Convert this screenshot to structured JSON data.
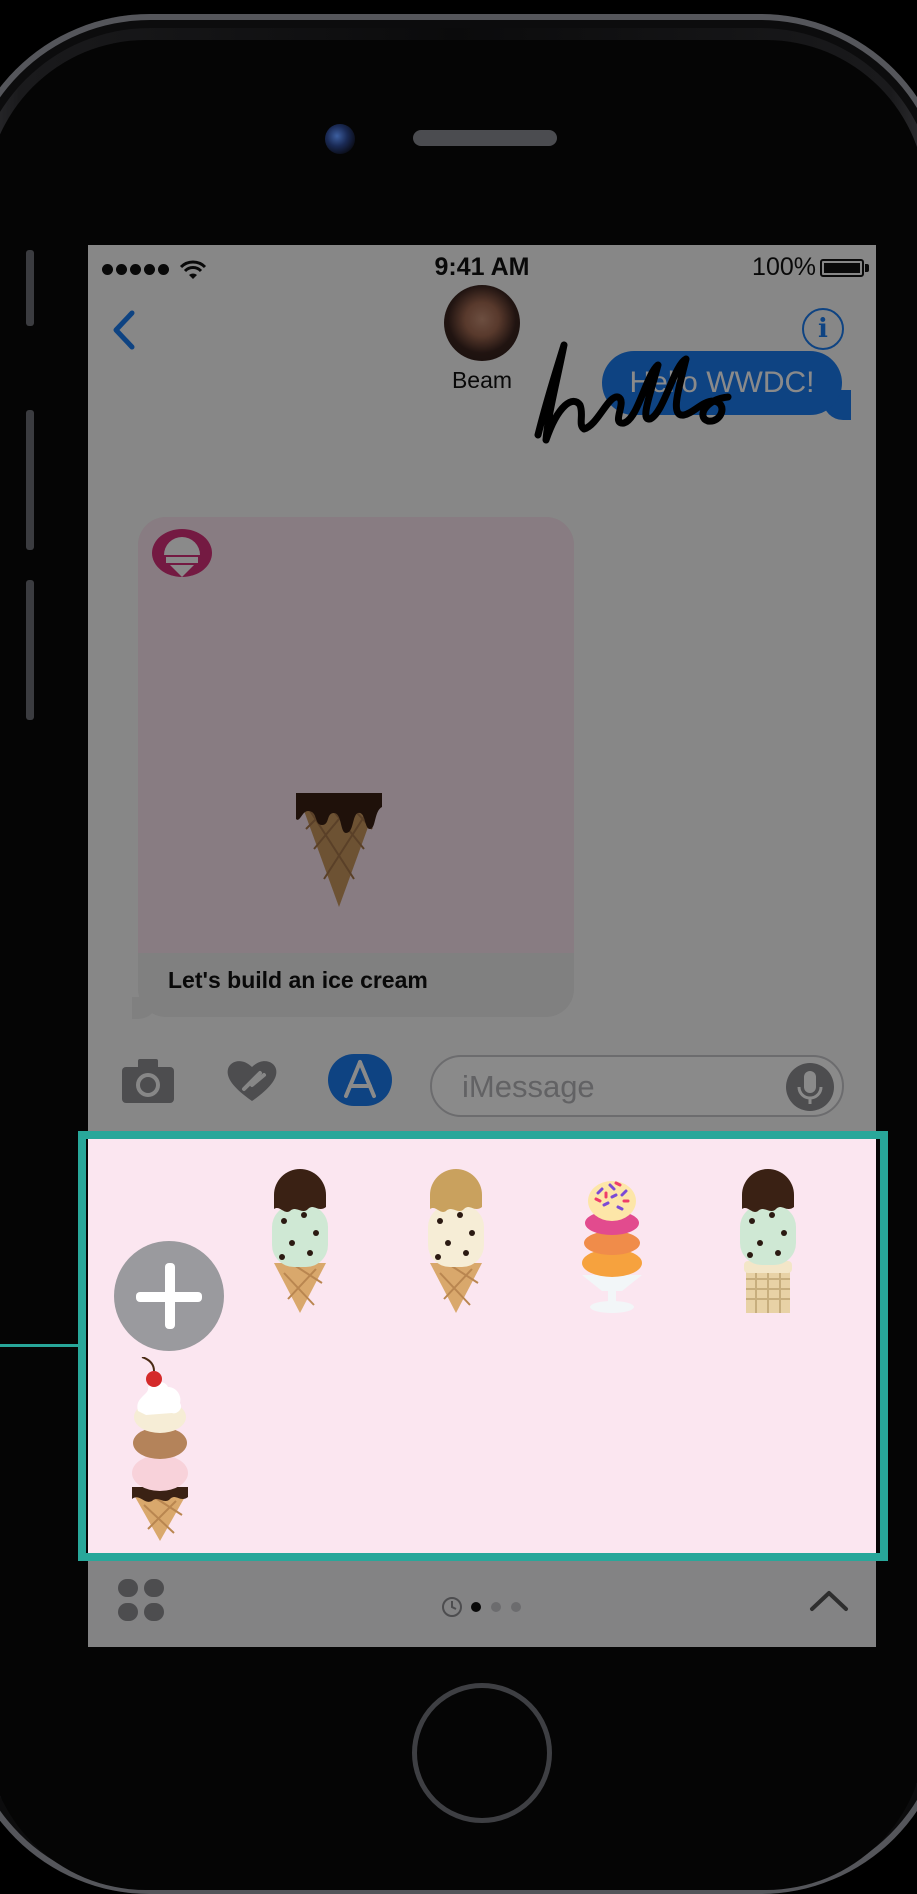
{
  "status_bar": {
    "time": "9:41 AM",
    "battery": "100%",
    "signal_bars": 5,
    "wifi_icon": "wifi-icon"
  },
  "nav": {
    "contact_name": "Beam",
    "back_icon": "chevron-left-icon",
    "info_icon": "info-icon",
    "info_glyph": "i"
  },
  "messages": {
    "outgoing_text": "Hello WWDC!",
    "handwriting_icon": "handwritten-hello-ink",
    "card_caption": "Let's build an ice cream"
  },
  "composer": {
    "placeholder": "iMessage",
    "camera_icon": "camera-icon",
    "digital_touch_icon": "digital-touch-heart-icon",
    "app_store_icon": "app-store-icon",
    "mic_icon": "microphone-icon"
  },
  "drawer": {
    "add_icon": "plus-icon",
    "stickers": [
      {
        "name": "chocolate-mint-chip-cone"
      },
      {
        "name": "caramel-cookie-dough-cone"
      },
      {
        "name": "sprinkle-sundae-cup"
      },
      {
        "name": "chocolate-mint-waffle-cone"
      },
      {
        "name": "cherry-triple-scoop-cone"
      }
    ],
    "page_count": 3,
    "active_page": 1,
    "apps_icon": "app-drawer-icon",
    "recents_icon": "clock-icon",
    "expand_icon": "chevron-up-icon"
  },
  "colors": {
    "imessage_blue": "#1b7cf0",
    "drawer_pink": "#fbe6f0",
    "highlight_teal": "#28a79a"
  }
}
